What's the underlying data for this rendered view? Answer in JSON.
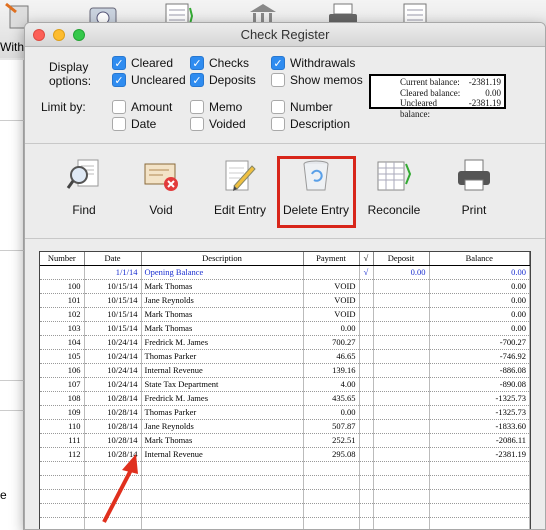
{
  "window": {
    "title": "Check Register"
  },
  "background": {
    "withdrawals_label": "Withd",
    "bottom_label": "e"
  },
  "display_options": {
    "label": "Display options:",
    "items": [
      {
        "label": "Cleared",
        "checked": true
      },
      {
        "label": "Checks",
        "checked": true
      },
      {
        "label": "Withdrawals",
        "checked": true
      },
      {
        "label": "Uncleared",
        "checked": true
      },
      {
        "label": "Deposits",
        "checked": true
      },
      {
        "label": "Show memos",
        "checked": false
      }
    ]
  },
  "limit_by": {
    "label": "Limit by:",
    "items": [
      {
        "label": "Amount",
        "checked": false
      },
      {
        "label": "Memo",
        "checked": false
      },
      {
        "label": "Number",
        "checked": false
      },
      {
        "label": "Date",
        "checked": false
      },
      {
        "label": "Voided",
        "checked": false
      },
      {
        "label": "Description",
        "checked": false
      }
    ]
  },
  "balances": {
    "current_label": "Current balance:",
    "current_value": "-2381.19",
    "cleared_label": "Cleared balance:",
    "cleared_value": "0.00",
    "uncleared_label": "Uncleared balance:",
    "uncleared_value": "-2381.19"
  },
  "toolbar": {
    "find": "Find",
    "void": "Void",
    "edit_entry": "Edit Entry",
    "delete_entry": "Delete Entry",
    "reconcile": "Reconcile",
    "print": "Print"
  },
  "ledger": {
    "columns": [
      "Number",
      "Date",
      "Description",
      "Payment",
      "√",
      "Deposit",
      "Balance"
    ],
    "rows": [
      {
        "number": "",
        "date": "1/1/14",
        "description": "Opening Balance",
        "payment": "",
        "cleared": "√",
        "deposit": "0.00",
        "balance": "0.00",
        "highlight": true
      },
      {
        "number": "100",
        "date": "10/15/14",
        "description": "Mark Thomas",
        "payment": "VOID",
        "cleared": "",
        "deposit": "",
        "balance": "0.00"
      },
      {
        "number": "101",
        "date": "10/15/14",
        "description": "Jane Reynolds",
        "payment": "VOID",
        "cleared": "",
        "deposit": "",
        "balance": "0.00"
      },
      {
        "number": "102",
        "date": "10/15/14",
        "description": "Mark Thomas",
        "payment": "VOID",
        "cleared": "",
        "deposit": "",
        "balance": "0.00"
      },
      {
        "number": "103",
        "date": "10/15/14",
        "description": "Mark Thomas",
        "payment": "0.00",
        "cleared": "",
        "deposit": "",
        "balance": "0.00"
      },
      {
        "number": "104",
        "date": "10/24/14",
        "description": "Fredrick M. James",
        "payment": "700.27",
        "cleared": "",
        "deposit": "",
        "balance": "-700.27"
      },
      {
        "number": "105",
        "date": "10/24/14",
        "description": "Thomas Parker",
        "payment": "46.65",
        "cleared": "",
        "deposit": "",
        "balance": "-746.92"
      },
      {
        "number": "106",
        "date": "10/24/14",
        "description": "Internal Revenue",
        "payment": "139.16",
        "cleared": "",
        "deposit": "",
        "balance": "-886.08"
      },
      {
        "number": "107",
        "date": "10/24/14",
        "description": "State Tax Department",
        "payment": "4.00",
        "cleared": "",
        "deposit": "",
        "balance": "-890.08"
      },
      {
        "number": "108",
        "date": "10/28/14",
        "description": "Fredrick M. James",
        "payment": "435.65",
        "cleared": "",
        "deposit": "",
        "balance": "-1325.73"
      },
      {
        "number": "109",
        "date": "10/28/14",
        "description": "Thomas Parker",
        "payment": "0.00",
        "cleared": "",
        "deposit": "",
        "balance": "-1325.73"
      },
      {
        "number": "110",
        "date": "10/28/14",
        "description": "Jane Reynolds",
        "payment": "507.87",
        "cleared": "",
        "deposit": "",
        "balance": "-1833.60"
      },
      {
        "number": "111",
        "date": "10/28/14",
        "description": "Mark Thomas",
        "payment": "252.51",
        "cleared": "",
        "deposit": "",
        "balance": "-2086.11"
      },
      {
        "number": "112",
        "date": "10/28/14",
        "description": "Internal Revenue",
        "payment": "295.08",
        "cleared": "",
        "deposit": "",
        "balance": "-2381.19"
      },
      {
        "number": "",
        "date": "",
        "description": "",
        "payment": "",
        "cleared": "",
        "deposit": "",
        "balance": ""
      },
      {
        "number": "",
        "date": "",
        "description": "",
        "payment": "",
        "cleared": "",
        "deposit": "",
        "balance": ""
      },
      {
        "number": "",
        "date": "",
        "description": "",
        "payment": "",
        "cleared": "",
        "deposit": "",
        "balance": ""
      },
      {
        "number": "",
        "date": "",
        "description": "",
        "payment": "",
        "cleared": "",
        "deposit": "",
        "balance": ""
      },
      {
        "number": "",
        "date": "",
        "description": "",
        "payment": "",
        "cleared": "",
        "deposit": "",
        "balance": ""
      }
    ]
  },
  "colors": {
    "highlight_box": "#d8261a",
    "arrow": "#e0301e",
    "checkbox_on": "#2f8cf0",
    "opening_row": "#1a2fd0"
  }
}
